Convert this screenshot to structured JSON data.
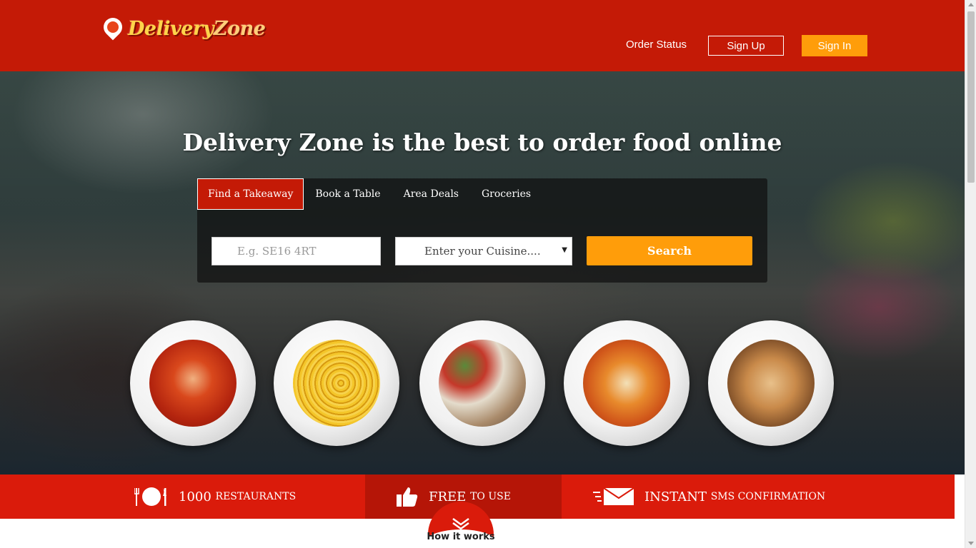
{
  "brand": {
    "name_part1": "Delivery",
    "name_part2": "Zone"
  },
  "header": {
    "order_status": "Order Status",
    "sign_up": "Sign Up",
    "sign_in": "Sign In"
  },
  "hero": {
    "title": "Delivery Zone is the best to order food online",
    "tabs": [
      "Find a Takeaway",
      "Book a Table",
      "Area Deals",
      "Groceries"
    ],
    "active_tab": "Find a Takeaway",
    "postcode_placeholder": "E.g. SE16 4RT",
    "cuisine_selected": "Enter your Cuisine....",
    "search_button": "Search"
  },
  "features": [
    {
      "big": "1000",
      "small": "RESTAURANTS",
      "icon": "dining-plate-icon"
    },
    {
      "big": "FREE",
      "small": "TO USE",
      "icon": "thumbs-up-icon"
    },
    {
      "big": "INSTANT",
      "small": "SMS CONFIRMATION",
      "icon": "fast-mail-icon"
    }
  ],
  "how_it_works": "How it works",
  "colors": {
    "brand_red": "#c41a06",
    "band_red": "#da1b0b",
    "accent_orange": "#ff9d0a"
  }
}
